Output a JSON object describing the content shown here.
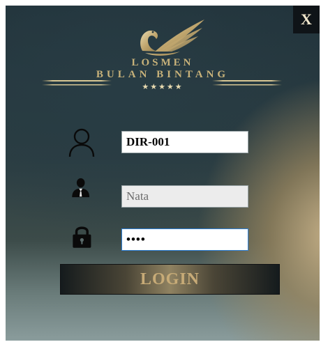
{
  "window": {
    "close_label": "X"
  },
  "logo": {
    "line1": "LOSMEN",
    "line2": "BULAN BINTANG",
    "stars": "★★★★★",
    "brand_color": "#c8b27a"
  },
  "form": {
    "user_id": "DIR-001",
    "name": "Nata",
    "password": "••••"
  },
  "icons": {
    "user_id": "user-outline-icon",
    "name": "person-suit-icon",
    "password": "lock-icon"
  },
  "login_label": "LOGIN",
  "colors": {
    "accent_gold": "#c7ab77",
    "focus_border": "#2d7fd6"
  }
}
